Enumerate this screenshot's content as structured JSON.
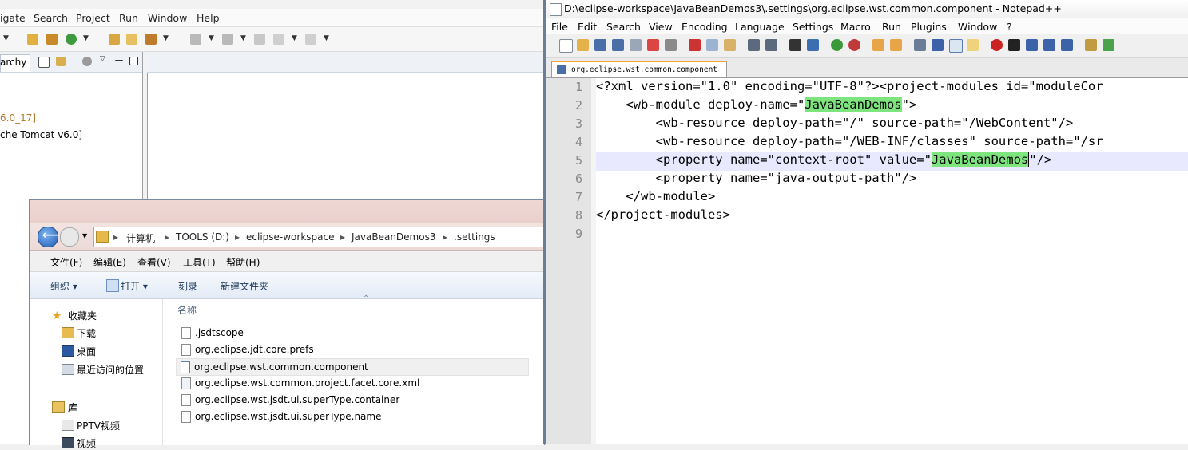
{
  "eclipse": {
    "menu": [
      "igate",
      "Search",
      "Project",
      "Run",
      "Window",
      "Help"
    ],
    "left_tab_label": "archy",
    "tree_items": [
      "6.0_17]",
      "che Tomcat v6.0]"
    ]
  },
  "explorer": {
    "breadcrumb": [
      "计算机",
      "TOOLS (D:)",
      "eclipse-workspace",
      "JavaBeanDemos3",
      ".settings"
    ],
    "menu": [
      "文件(F)",
      "编辑(E)",
      "查看(V)",
      "工具(T)",
      "帮助(H)"
    ],
    "commands": {
      "organize": "组织 ▾",
      "open": "打开 ▾",
      "burn": "刻录",
      "new_folder": "新建文件夹"
    },
    "nav": {
      "favorites": "收藏夹",
      "downloads": "下载",
      "desktop": "桌面",
      "recent": "最近访问的位置",
      "library": "库",
      "pptv": "PPTV视频",
      "video": "视频"
    },
    "column_name": "名称",
    "files": [
      ".jsdtscope",
      "org.eclipse.jdt.core.prefs",
      "org.eclipse.wst.common.component",
      "org.eclipse.wst.common.project.facet.core.xml",
      "org.eclipse.wst.jsdt.ui.superType.container",
      "org.eclipse.wst.jsdt.ui.superType.name"
    ],
    "selected_file_index": 2
  },
  "notepad": {
    "title": "D:\\eclipse-workspace\\JavaBeanDemos3\\.settings\\org.eclipse.wst.common.component - Notepad++",
    "menu": [
      "File",
      "Edit",
      "Search",
      "View",
      "Encoding",
      "Language",
      "Settings",
      "Macro",
      "Run",
      "Plugins",
      "Window",
      "?"
    ],
    "tab_label": "org.eclipse.wst.common.component",
    "line_numbers": [
      "1",
      "2",
      "3",
      "4",
      "5",
      "6",
      "7",
      "8",
      "9"
    ],
    "code": {
      "l1": "<?xml version=\"1.0\" encoding=\"UTF-8\"?><project-modules id=\"moduleCor",
      "l2a": "    <wb-module deploy-name=\"",
      "l2b": "JavaBeanDemos",
      "l2c": "\">",
      "l3": "        <wb-resource deploy-path=\"/\" source-path=\"/WebContent\"/>",
      "l4": "        <wb-resource deploy-path=\"/WEB-INF/classes\" source-path=\"/sr",
      "l5a": "        <property name=\"context-root\" value=\"",
      "l5b": "JavaBeanDemos",
      "l5c": "\"/>",
      "l6": "        <property name=\"java-output-path\"/>",
      "l7": "    </wb-module>",
      "l8": "</project-modules>",
      "l9": ""
    },
    "current_line": 5,
    "highlight_color": "#7ee57e"
  }
}
